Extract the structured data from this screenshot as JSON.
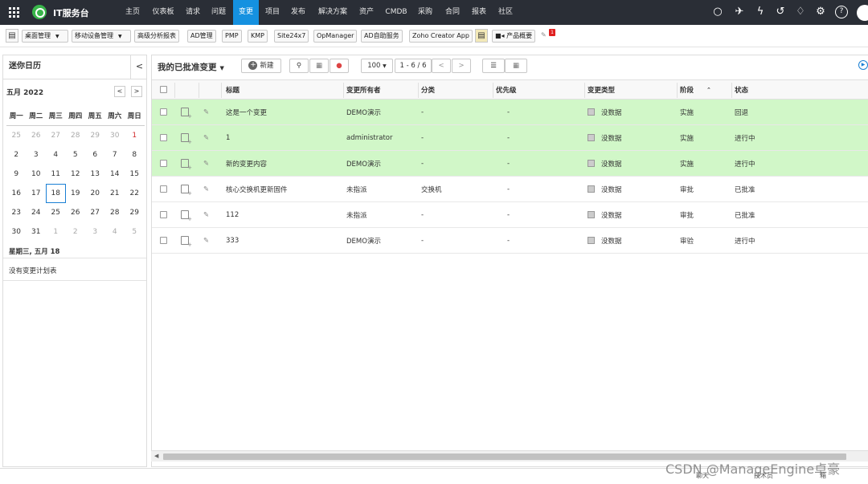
{
  "topnav": {
    "brand": "IT服务台",
    "items": [
      {
        "label": "主页"
      },
      {
        "label": "仪表板"
      },
      {
        "label": "请求"
      },
      {
        "label": "问题"
      },
      {
        "label": "变更"
      },
      {
        "label": "项目"
      },
      {
        "label": "发布"
      },
      {
        "label": "解决方案"
      },
      {
        "label": "资产"
      },
      {
        "label": "CMDB"
      },
      {
        "label": "采购"
      },
      {
        "label": "合同"
      },
      {
        "label": "报表"
      },
      {
        "label": "社区"
      }
    ],
    "active_index": 4,
    "active_color": "#1591e0",
    "bar_color": "#2a2e36",
    "icons": [
      "search-icon",
      "rocket-icon",
      "lightning-icon",
      "history-icon",
      "bell-icon",
      "gear-icon",
      "help-icon",
      "avatar"
    ]
  },
  "toolbar": {
    "buttons": [
      {
        "label": "桌面管理",
        "dropdown": true
      },
      {
        "label": "移动设备管理",
        "dropdown": true
      },
      {
        "label": "高级分析报表"
      },
      {
        "label": "AD管理"
      },
      {
        "label": "PMP"
      },
      {
        "label": "KMP"
      },
      {
        "label": "Site24x7"
      },
      {
        "label": "OpManager"
      },
      {
        "label": "AD自助服务"
      },
      {
        "label": "Zoho Creator App"
      },
      {
        "label": "产品概要"
      }
    ],
    "badge_count": "1"
  },
  "sidebar": {
    "title": "迷你日历",
    "month_label": "五月 2022",
    "weekdays": [
      "周一",
      "周二",
      "周三",
      "周四",
      "周五",
      "周六",
      "周日"
    ],
    "weeks": [
      [
        "25",
        "26",
        "27",
        "28",
        "29",
        "30",
        "1"
      ],
      [
        "2",
        "3",
        "4",
        "5",
        "6",
        "7",
        "8"
      ],
      [
        "9",
        "10",
        "11",
        "12",
        "13",
        "14",
        "15"
      ],
      [
        "16",
        "17",
        "18",
        "19",
        "20",
        "21",
        "22"
      ],
      [
        "23",
        "24",
        "25",
        "26",
        "27",
        "28",
        "29"
      ],
      [
        "30",
        "31",
        "1",
        "2",
        "3",
        "4",
        "5"
      ]
    ],
    "selected_date_label": "星期三, 五月 18",
    "no_plan_text": "没有变更计划表"
  },
  "main": {
    "view_title": "我的已批准变更",
    "new_button_label": "新建",
    "page_size": "100",
    "range_label": "1 - 6 / 6",
    "columns": [
      "标题",
      "变更所有者",
      "分类",
      "优先级",
      "变更类型",
      "阶段",
      "状态"
    ],
    "rows": [
      {
        "title": "这是一个变更",
        "owner": "DEMO演示",
        "category": "-",
        "priority": "-",
        "type": "没数据",
        "stage": "实施",
        "status": "回退",
        "highlight": true
      },
      {
        "title": "1",
        "owner": "administrator",
        "category": "-",
        "priority": "-",
        "type": "没数据",
        "stage": "实施",
        "status": "进行中",
        "highlight": true
      },
      {
        "title": "新的变更内容",
        "owner": "DEMO演示",
        "category": "-",
        "priority": "-",
        "type": "没数据",
        "stage": "实施",
        "status": "进行中",
        "highlight": true
      },
      {
        "title": "核心交换机更新固件",
        "owner": "未指派",
        "category": "交换机",
        "priority": "-",
        "type": "没数据",
        "stage": "审批",
        "status": "已批准",
        "highlight": false
      },
      {
        "title": "112",
        "owner": "未指派",
        "category": "-",
        "priority": "-",
        "type": "没数据",
        "stage": "审批",
        "status": "已批准",
        "highlight": false
      },
      {
        "title": "333",
        "owner": "DEMO演示",
        "category": "-",
        "priority": "-",
        "type": "没数据",
        "stage": "审验",
        "status": "进行中",
        "highlight": false
      }
    ],
    "highlight_color": "#d1f7c8"
  },
  "footer": {
    "items": [
      "聊天",
      "技术员",
      "箱"
    ]
  },
  "watermark": "CSDN @ManageEngine卓豪"
}
